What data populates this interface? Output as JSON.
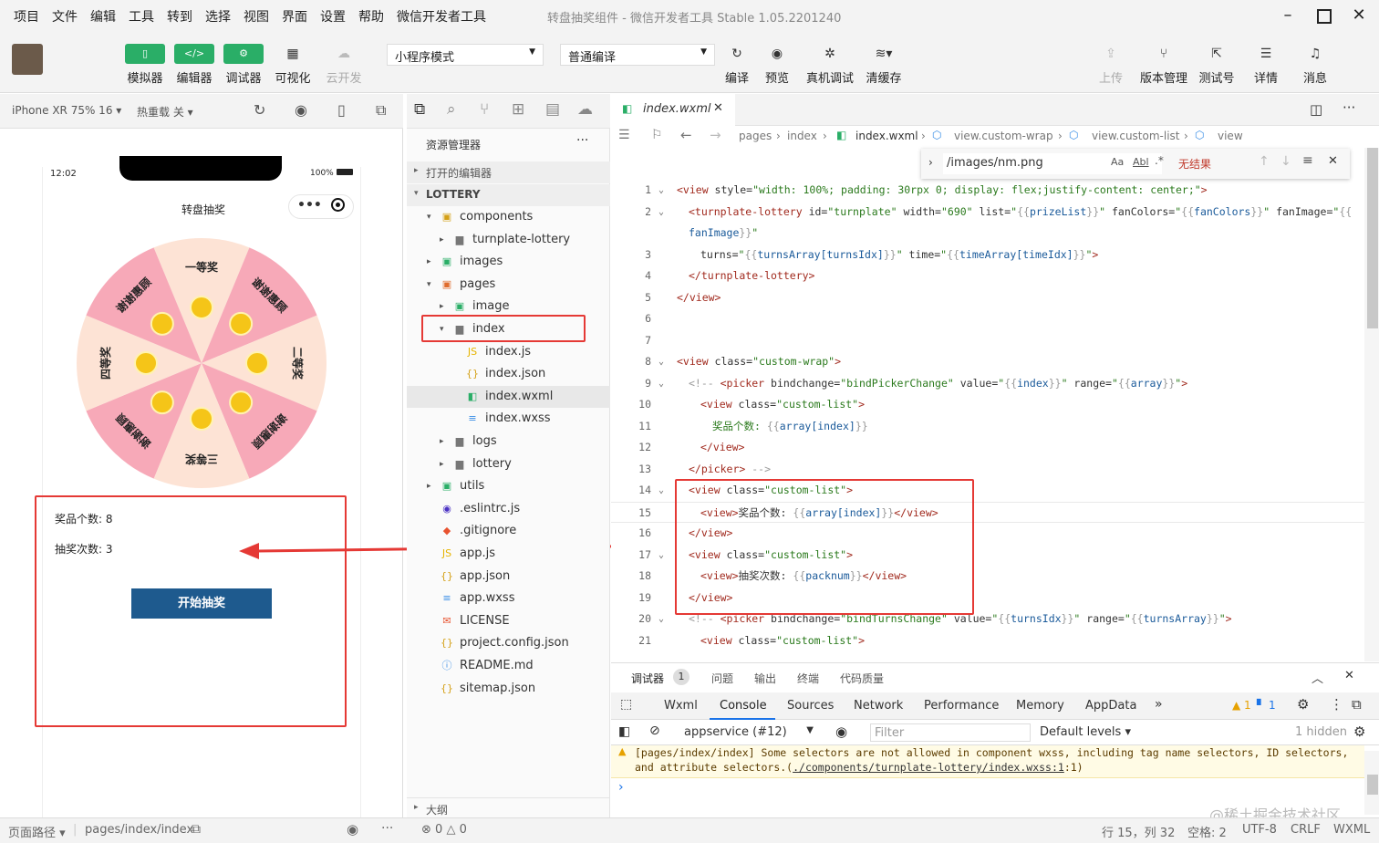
{
  "menu": [
    "项目",
    "文件",
    "编辑",
    "工具",
    "转到",
    "选择",
    "视图",
    "界面",
    "设置",
    "帮助",
    "微信开发者工具"
  ],
  "window_title": "转盘抽奖组件 - 微信开发者工具 Stable 1.05.2201240",
  "toolbar": {
    "simulator": "模拟器",
    "editor": "编辑器",
    "debugger": "调试器",
    "visual": "可视化",
    "cloud": "云开发",
    "mode_select": "小程序模式",
    "compile_select": "普通编译",
    "compile": "编译",
    "preview": "预览",
    "real_debug": "真机调试",
    "clear_cache": "清缓存",
    "upload": "上传",
    "version": "版本管理",
    "test_no": "测试号",
    "details": "详情",
    "messages": "消息"
  },
  "simbar": {
    "device": "iPhone XR 75% 16",
    "hot_reload": "热重载 关"
  },
  "phone": {
    "time": "12:02",
    "battery": "100%",
    "nav_title": "转盘抽奖",
    "prizes": [
      "一等奖",
      "谢谢惠顾",
      "二等奖",
      "谢谢惠顾",
      "三等奖",
      "谢谢惠顾",
      "四等奖",
      "谢谢惠顾"
    ],
    "prize_count_label": "奖品个数:",
    "prize_count": "8",
    "draw_count_label": "抽奖次数:",
    "draw_count": "3",
    "start_button": "开始抽奖"
  },
  "explorer": {
    "title": "资源管理器",
    "open_editors": "打开的编辑器",
    "root": "LOTTERY",
    "outline": "大纲",
    "items": [
      "components",
      "turnplate-lottery",
      "images",
      "pages",
      "image",
      "index",
      "index.js",
      "index.json",
      "index.wxml",
      "index.wxss",
      "logs",
      "lottery",
      "utils",
      ".eslintrc.js",
      ".gitignore",
      "app.js",
      "app.json",
      "app.wxss",
      "LICENSE",
      "project.config.json",
      "README.md",
      "sitemap.json"
    ]
  },
  "editor": {
    "tab": "index.wxml",
    "breadcrumb": [
      "pages",
      "index",
      "index.wxml",
      "view.custom-wrap",
      "view.custom-list",
      "view"
    ],
    "find_text": "/images/nm.png",
    "find_result": "无结果",
    "find_aa": "Aa",
    "find_ab": "Abl"
  },
  "code_lines": [
    {
      "n": "1",
      "x": 0,
      "parts": [
        [
          "t",
          "<view "
        ],
        [
          "a",
          "style="
        ],
        [
          "s",
          "\"width: 100%; padding: 30rpx 0; display: flex;justify-content: center;\""
        ],
        [
          "t",
          ">"
        ]
      ]
    },
    {
      "n": "2",
      "x": 1,
      "parts": [
        [
          "t",
          "<turnplate-lottery "
        ],
        [
          "a",
          "id="
        ],
        [
          "s",
          "\"turnplate\""
        ],
        [
          "a",
          " width="
        ],
        [
          "s",
          "\"690\""
        ],
        [
          "a",
          " list="
        ],
        [
          "s",
          "\""
        ],
        [
          "c",
          "{{"
        ],
        [
          "b",
          "prizeList"
        ],
        [
          "c",
          "}}"
        ],
        [
          "s",
          "\""
        ],
        [
          "a",
          " fanColors="
        ],
        [
          "s",
          "\""
        ],
        [
          "c",
          "{{"
        ],
        [
          "b",
          "fanColors"
        ],
        [
          "c",
          "}}"
        ],
        [
          "s",
          "\""
        ],
        [
          "a",
          " fanImage="
        ],
        [
          "s",
          "\""
        ],
        [
          "c",
          "{{"
        ]
      ]
    },
    {
      "n": "",
      "x": 1,
      "parts": [
        [
          "b",
          "fanImage"
        ],
        [
          "c",
          "}}"
        ],
        [
          "s",
          "\""
        ]
      ]
    },
    {
      "n": "3",
      "x": 2,
      "parts": [
        [
          "a",
          "turns="
        ],
        [
          "s",
          "\""
        ],
        [
          "c",
          "{{"
        ],
        [
          "b",
          "turnsArray[turnsIdx]"
        ],
        [
          "c",
          "}}"
        ],
        [
          "s",
          "\""
        ],
        [
          "a",
          " time="
        ],
        [
          "s",
          "\""
        ],
        [
          "c",
          "{{"
        ],
        [
          "b",
          "timeArray[timeIdx]"
        ],
        [
          "c",
          "}}"
        ],
        [
          "s",
          "\""
        ],
        [
          "t",
          ">"
        ]
      ]
    },
    {
      "n": "4",
      "x": 1,
      "parts": [
        [
          "t",
          "</turnplate-lottery>"
        ]
      ]
    },
    {
      "n": "5",
      "x": 0,
      "parts": [
        [
          "t",
          "</view>"
        ]
      ]
    },
    {
      "n": "6",
      "x": 0,
      "parts": []
    },
    {
      "n": "7",
      "x": 0,
      "parts": []
    },
    {
      "n": "8",
      "x": 0,
      "parts": [
        [
          "t",
          "<view "
        ],
        [
          "a",
          "class="
        ],
        [
          "s",
          "\"custom-wrap\""
        ],
        [
          "t",
          ">"
        ]
      ]
    },
    {
      "n": "9",
      "x": 1,
      "parts": [
        [
          "c",
          "<!-- "
        ],
        [
          "t",
          "<picker "
        ],
        [
          "a",
          "bindchange="
        ],
        [
          "s",
          "\"bindPickerChange\""
        ],
        [
          "a",
          "   value="
        ],
        [
          "s",
          "\""
        ],
        [
          "c",
          "{{"
        ],
        [
          "b",
          "index"
        ],
        [
          "c",
          "}}"
        ],
        [
          "s",
          "\""
        ],
        [
          "a",
          " range="
        ],
        [
          "s",
          "\""
        ],
        [
          "c",
          "{{"
        ],
        [
          "b",
          "array"
        ],
        [
          "c",
          "}}"
        ],
        [
          "s",
          "\""
        ],
        [
          "t",
          ">"
        ]
      ]
    },
    {
      "n": "10",
      "x": 2,
      "parts": [
        [
          "t",
          "<view "
        ],
        [
          "a",
          "class="
        ],
        [
          "s",
          "\"custom-list\""
        ],
        [
          "t",
          ">"
        ]
      ]
    },
    {
      "n": "11",
      "x": 3,
      "parts": [
        [
          "s",
          "奖品个数: "
        ],
        [
          "c",
          "{{"
        ],
        [
          "b",
          "array[index]"
        ],
        [
          "c",
          "}}"
        ]
      ]
    },
    {
      "n": "12",
      "x": 2,
      "parts": [
        [
          "t",
          "</view>"
        ]
      ]
    },
    {
      "n": "13",
      "x": 1,
      "parts": [
        [
          "t",
          "</picker>"
        ],
        [
          "c",
          " -->"
        ]
      ]
    },
    {
      "n": "14",
      "x": 1,
      "parts": [
        [
          "t",
          "<view "
        ],
        [
          "a",
          "class="
        ],
        [
          "s",
          "\"custom-list\""
        ],
        [
          "t",
          ">"
        ]
      ]
    },
    {
      "n": "15",
      "x": 2,
      "parts": [
        [
          "t",
          "<view>"
        ],
        [
          "a",
          "奖品个数: "
        ],
        [
          "c",
          "{{"
        ],
        [
          "b",
          "array[index]"
        ],
        [
          "c",
          "}}"
        ],
        [
          "t",
          "</view>"
        ]
      ]
    },
    {
      "n": "16",
      "x": 1,
      "parts": [
        [
          "t",
          "</view>"
        ]
      ]
    },
    {
      "n": "17",
      "x": 1,
      "parts": [
        [
          "t",
          "<view "
        ],
        [
          "a",
          "class="
        ],
        [
          "s",
          "\"custom-list\""
        ],
        [
          "t",
          ">"
        ]
      ]
    },
    {
      "n": "18",
      "x": 2,
      "parts": [
        [
          "t",
          "<view>"
        ],
        [
          "a",
          "抽奖次数: "
        ],
        [
          "c",
          "{{"
        ],
        [
          "b",
          "packnum"
        ],
        [
          "c",
          "}}"
        ],
        [
          "t",
          "</view>"
        ]
      ]
    },
    {
      "n": "19",
      "x": 1,
      "parts": [
        [
          "t",
          "</view>"
        ]
      ]
    },
    {
      "n": "20",
      "x": 1,
      "parts": [
        [
          "c",
          "<!-- "
        ],
        [
          "t",
          "<picker "
        ],
        [
          "a",
          "bindchange="
        ],
        [
          "s",
          "\"bindTurnsChange\""
        ],
        [
          "a",
          " value="
        ],
        [
          "s",
          "\""
        ],
        [
          "c",
          "{{"
        ],
        [
          "b",
          "turnsIdx"
        ],
        [
          "c",
          "}}"
        ],
        [
          "s",
          "\""
        ],
        [
          "a",
          " range="
        ],
        [
          "s",
          "\""
        ],
        [
          "c",
          "{{"
        ],
        [
          "b",
          "turnsArray"
        ],
        [
          "c",
          "}}"
        ],
        [
          "s",
          "\""
        ],
        [
          "t",
          ">"
        ]
      ]
    },
    {
      "n": "21",
      "x": 2,
      "parts": [
        [
          "t",
          "<view "
        ],
        [
          "a",
          "class="
        ],
        [
          "s",
          "\"custom-list\""
        ],
        [
          "t",
          ">"
        ]
      ]
    }
  ],
  "devtools": {
    "tabs": [
      "调试器",
      "问题",
      "输出",
      "终端",
      "代码质量"
    ],
    "badge": "1",
    "panels": [
      "Wxml",
      "Console",
      "Sources",
      "Network",
      "Performance",
      "Memory",
      "AppData"
    ],
    "context": "appservice (#12)",
    "filter": "Filter",
    "levels": "Default levels",
    "hidden": "1 hidden",
    "warn_count": "1",
    "info_count": "1",
    "message": "[pages/index/index] Some selectors are not allowed in component wxss, including tag name selectors, ID selectors, and attribute selectors.(",
    "link": "./components/turnplate-lottery/index.wxss:1",
    "msg_end": ":1)"
  },
  "statusbar": {
    "path_label": "页面路径",
    "path": "pages/index/index",
    "errors": "0",
    "warnings": "0",
    "pos": "行 15，列 32",
    "spaces": "空格: 2",
    "enc": "UTF-8",
    "eol": "CRLF",
    "lang": "WXML"
  },
  "watermark": "@稀土掘金技术社区",
  "colors": {
    "green": "#2aae67",
    "red_box": "#e53935",
    "wheel_pink": "#f7a9b8",
    "wheel_cream": "#fde3d5",
    "button_blue": "#1e5a8e"
  }
}
